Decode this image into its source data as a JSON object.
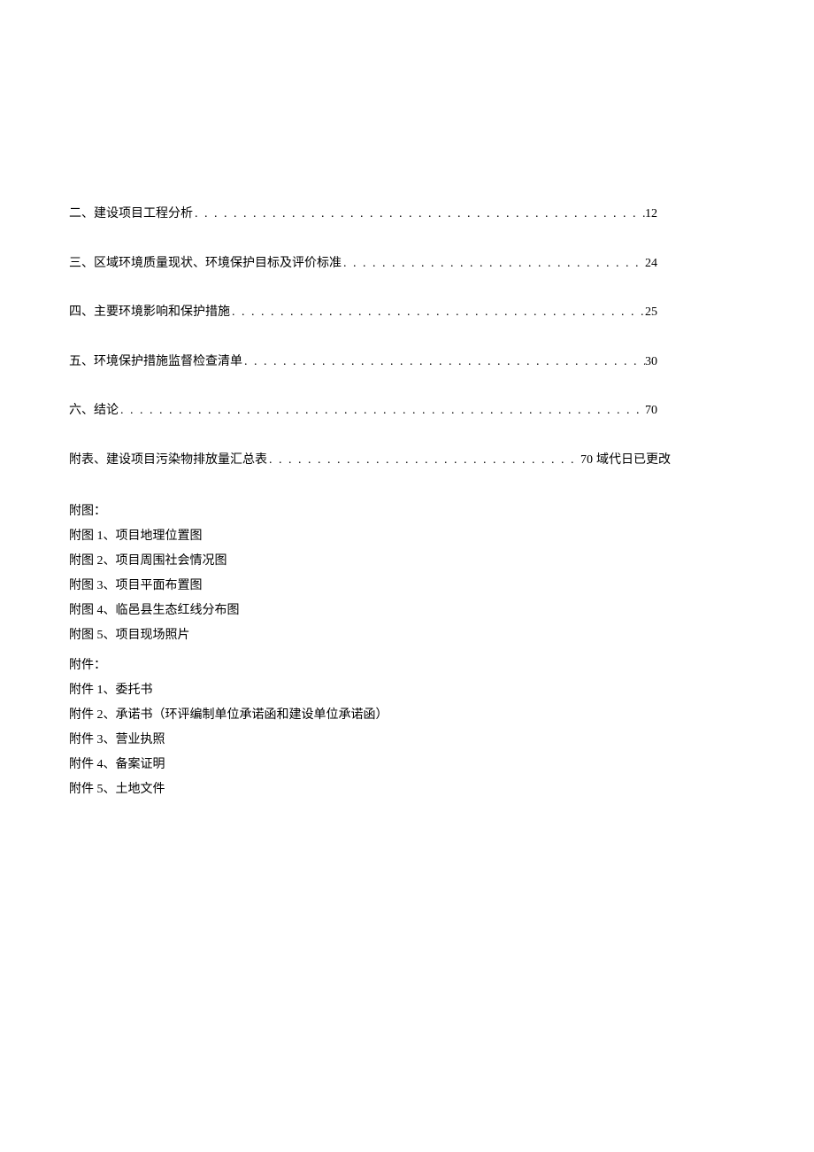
{
  "toc": [
    {
      "title": "二、建设项目工程分析",
      "page": "12",
      "suffix": ""
    },
    {
      "title": "三、区域环境质量现状、环境保护目标及评价标准",
      "page": "24",
      "suffix": ""
    },
    {
      "title": "四、主要环境影响和保护措施",
      "page": "25",
      "suffix": ""
    },
    {
      "title": "五、环境保护措施监督检查清单",
      "page": "30",
      "suffix": ""
    },
    {
      "title": "六、结论",
      "page": "70",
      "suffix": ""
    },
    {
      "title": "附表、建设项目污染物排放量汇总表",
      "page": "70",
      "suffix": "域代日已更改"
    }
  ],
  "figures": {
    "heading": "附图：",
    "items": [
      "附图 1、项目地理位置图",
      "附图 2、项目周围社会情况图",
      "附图 3、项目平面布置图",
      "附图 4、临邑县生态红线分布图",
      "附图 5、项目现场照片"
    ]
  },
  "attachments": {
    "heading": "附件：",
    "items": [
      "附件 1、委托书",
      "附件 2、承诺书（环评编制单位承诺函和建设单位承诺函）",
      "附件 3、营业执照",
      "附件 4、备案证明",
      "附件 5、土地文件"
    ]
  },
  "dots": ". . . . . . . . . . . . . . . . . . . . . . . . . . . . . . . . . . . . . . . . . . . . . . . . . . . . . . . . . . . . . . . . . . . . . . . . . . . . . . . . . . . . . . . . . . . . . . . . . . . . . . . . . . . . . . . . . . . . . . . . . . . . . . . . . . . . . . . ."
}
